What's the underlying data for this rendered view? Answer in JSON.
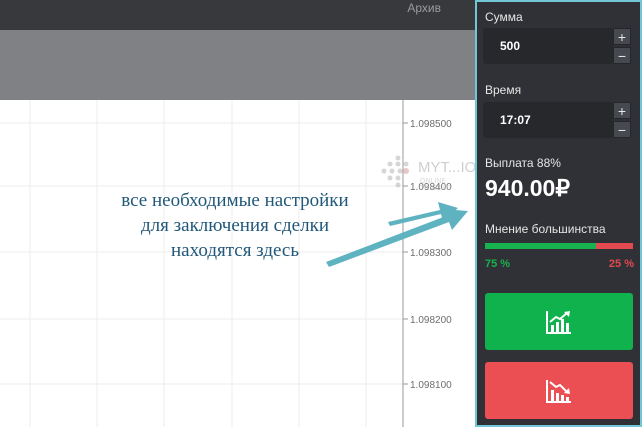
{
  "header": {
    "archive_label": "Архив"
  },
  "chart": {
    "price_levels": [
      "1.098500",
      "1.098400",
      "1.098300",
      "1.098200",
      "1.098100"
    ]
  },
  "watermark": {
    "brand": "MYT...ION",
    "tagline": "ONLINE TRADING"
  },
  "annotation": {
    "lines": [
      "все необходимые настройки",
      "для заключения сделки",
      "находятся здесь"
    ]
  },
  "panel": {
    "amount_label": "Сумма",
    "amount_value": "500",
    "time_label": "Время",
    "time_value": "17:07",
    "plus": "+",
    "minus": "−",
    "payout_label": "Выплата 88%",
    "payout_value": "940.00₽",
    "sentiment_label": "Мнение большинства",
    "sentiment_up": "75 %",
    "sentiment_down": "25 %",
    "sentiment_up_fraction": 0.75
  },
  "colors": {
    "up": "#0fb24c",
    "down": "#eb4e53",
    "highlight": "#72c7d6",
    "annotation": "#21587a"
  },
  "icons": {
    "call": "chart-up-icon",
    "put": "chart-down-icon"
  }
}
